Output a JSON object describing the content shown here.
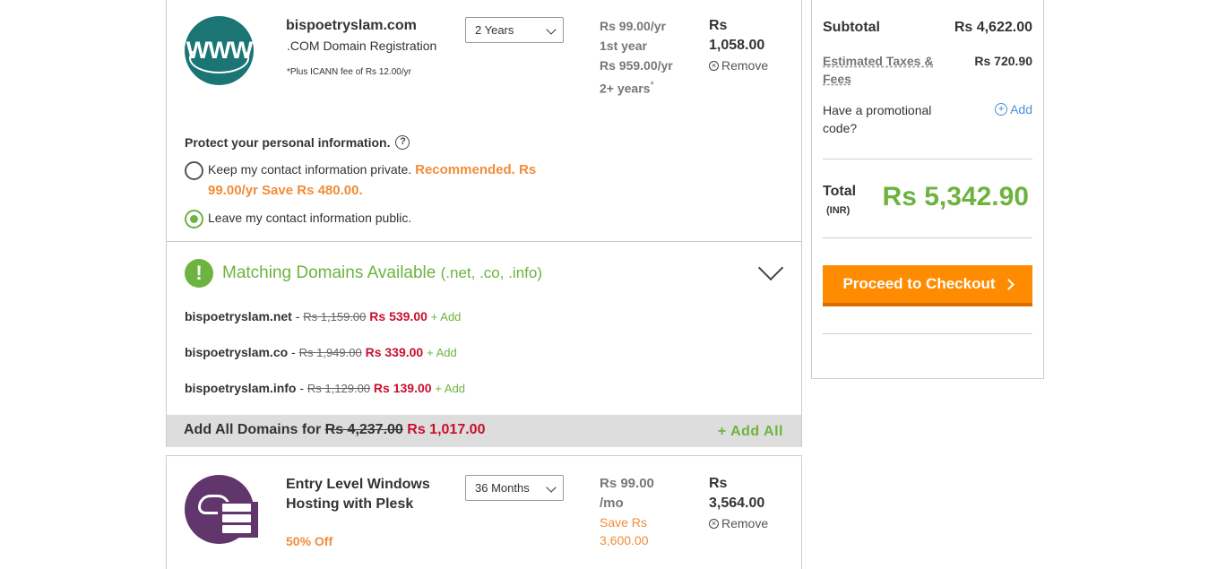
{
  "domain_item": {
    "logo_text": "WWW",
    "name": "bispoetryslam.com",
    "subtitle": ".COM Domain Registration",
    "icann_note": "*Plus ICANN fee of Rs 12.00/yr",
    "term_selected": "2 Years",
    "price_line1": "Rs 99.00/yr",
    "price_line2": "1st year",
    "price_line3": "Rs 959.00/yr",
    "price_line4": "2+ years",
    "price_asterisk": "*",
    "total_line1": "Rs",
    "total_line2": "1,058.00",
    "remove_label": "Remove",
    "privacy": {
      "title": "Protect your personal information.",
      "help": "?",
      "option_private": "Keep my contact information private.",
      "option_private_rec_1": "Recommended. Rs",
      "option_private_rec_2": "99.00/yr Save Rs 480.00.",
      "option_public": "Leave my contact information public.",
      "selected": "public"
    }
  },
  "matching": {
    "icon": "!",
    "title": "Matching Domains Available",
    "title_suffix": "(.net, .co, .info)",
    "domains": [
      {
        "name": "bispoetryslam.net",
        "sep": " - ",
        "old": "Rs 1,159.00",
        "new": "Rs 539.00",
        "add": "+ Add"
      },
      {
        "name": "bispoetryslam.co",
        "sep": " - ",
        "old": "Rs 1,949.00",
        "new": "Rs 339.00",
        "add": "+ Add"
      },
      {
        "name": "bispoetryslam.info",
        "sep": " - ",
        "old": "Rs 1,129.00",
        "new": "Rs 139.00",
        "add": "+ Add"
      }
    ],
    "add_all_prefix": "Add All Domains for",
    "add_all_old": "Rs 4,237.00",
    "add_all_new": "Rs 1,017.00",
    "add_all_button": "+ Add All"
  },
  "hosting_item": {
    "name_line1": "Entry Level Windows",
    "name_line2": "Hosting with Plesk",
    "discount": "50% Off",
    "term_selected": "36 Months",
    "price_line1": "Rs 99.00",
    "price_line2": "/mo",
    "save_line1": "Save Rs",
    "save_line2": "3,600.00",
    "total_line1": "Rs",
    "total_line2": "3,564.00",
    "remove_label": "Remove"
  },
  "summary": {
    "subtotal_label": "Subtotal",
    "subtotal_value": "Rs 4,622.00",
    "tax_label_1": "Estimated Taxes &",
    "tax_label_2": "Fees",
    "tax_value": "Rs 720.90",
    "promo_label_1": "Have a promotional",
    "promo_label_2": "code?",
    "promo_add": "Add",
    "total_label": "Total",
    "total_currency": "(INR)",
    "total_value": "Rs 5,342.90",
    "checkout_label": "Proceed to Checkout"
  },
  "colors": {
    "accent_green": "#6db33f",
    "checkout_orange": "#ff8b00",
    "sale_red": "#c8102e",
    "promo_blue": "#4a90d9"
  }
}
